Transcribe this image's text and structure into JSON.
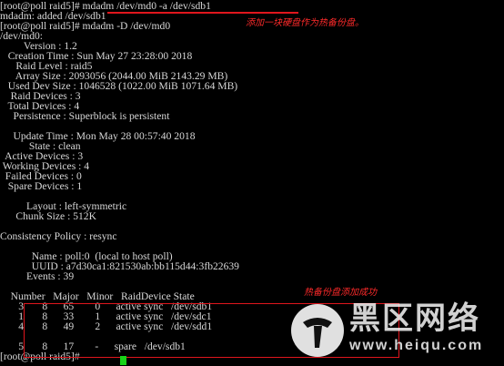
{
  "terminal": {
    "lines": [
      "[root@poll raid5]# mdadm /dev/md0 -a /dev/sdb1",
      "mdadm: added /dev/sdb1",
      "[root@poll raid5]# mdadm -D /dev/md0",
      "/dev/md0:",
      "         Version : 1.2",
      "   Creation Time : Sun May 27 23:28:00 2018",
      "      Raid Level : raid5",
      "      Array Size : 2093056 (2044.00 MiB 2143.29 MB)",
      "   Used Dev Size : 1046528 (1022.00 MiB 1071.64 MB)",
      "    Raid Devices : 3",
      "   Total Devices : 4",
      "     Persistence : Superblock is persistent",
      "",
      "     Update Time : Mon May 28 00:57:40 2018",
      "           State : clean",
      "  Active Devices : 3",
      " Working Devices : 4",
      "  Failed Devices : 0",
      "   Spare Devices : 1",
      "",
      "          Layout : left-symmetric",
      "      Chunk Size : 512K",
      "",
      "Consistency Policy : resync",
      "",
      "            Name : poll:0  (local to host poll)",
      "            UUID : a7d30ca1:821530ab:bb115d44:3fb22639",
      "          Events : 39",
      "",
      "    Number   Major   Minor   RaidDevice State",
      "       3       8      65        0      active sync   /dev/sdb1",
      "       1       8      33        1      active sync   /dev/sdc1",
      "       4       8      49        2      active sync   /dev/sdd1",
      "",
      "       5       8      17        -      spare   /dev/sdb1",
      "[root@poll raid5]# "
    ]
  },
  "annotations": {
    "add_hot_spare": "添加一块硬盘作为热备份盘。",
    "hot_spare_added": "热备份盘添加成功"
  },
  "watermark": {
    "title": "黑区网络",
    "url": "www.heiqu.com"
  },
  "colors": {
    "background": "#000000",
    "text": "#d7d7d7",
    "annotation": "#ff2a2a",
    "highlight_box": "#e0161d",
    "cursor": "#18d418"
  }
}
